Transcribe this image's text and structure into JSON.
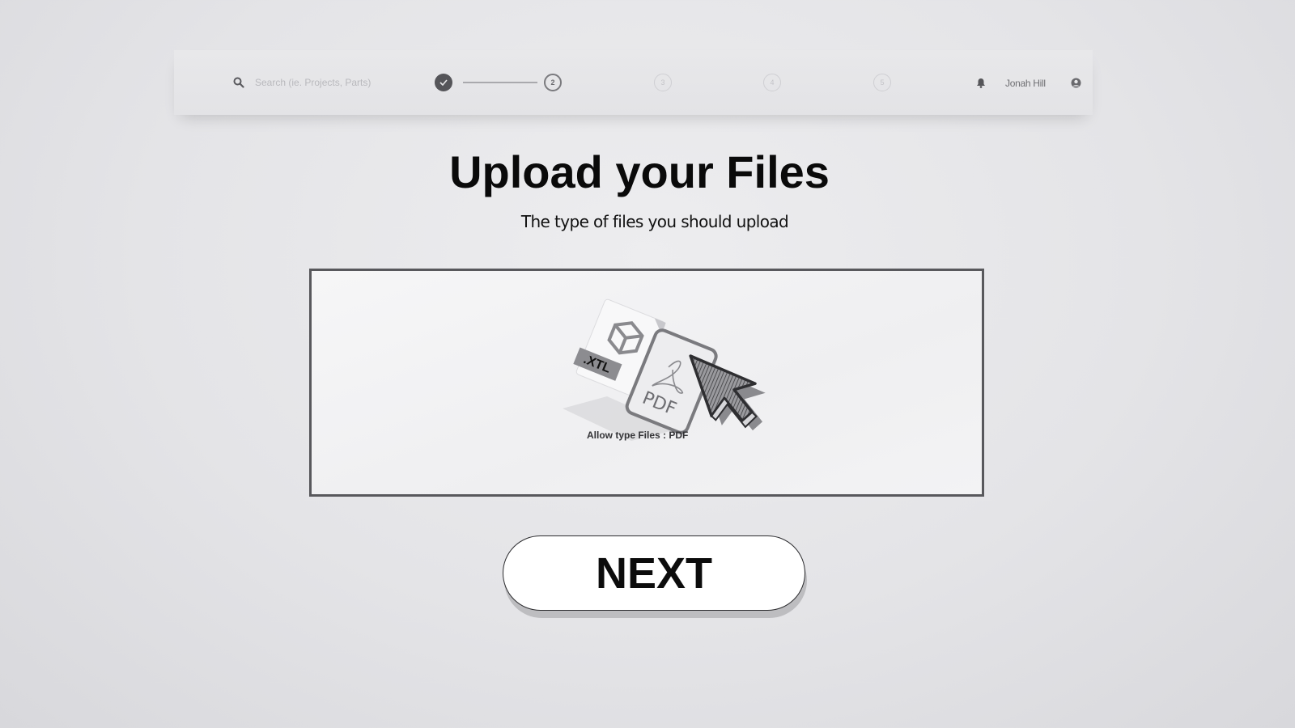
{
  "header": {
    "search": {
      "placeholder": "Search (ie. Projects, Parts)",
      "value": ""
    },
    "steps": [
      {
        "label": "",
        "state": "completed",
        "icon": "check-icon"
      },
      {
        "label": "2",
        "state": "current"
      },
      {
        "label": "3",
        "state": "upcoming"
      },
      {
        "label": "4",
        "state": "upcoming"
      },
      {
        "label": "5",
        "state": "upcoming"
      }
    ],
    "notification_icon": "bell-icon",
    "user": {
      "name": "Jonah Hill",
      "avatar_icon": "user-circle-icon"
    }
  },
  "main": {
    "title": "Upload your Files",
    "subtitle": "The type of files you should upload",
    "dropzone": {
      "file_tags": [
        ".XTL",
        "PDF"
      ],
      "allowed_types_label": "Allow type Files : PDF",
      "icons": [
        "cube-icon",
        "pdf-icon",
        "cursor-icon"
      ]
    },
    "next_button": {
      "label": "NEXT"
    }
  },
  "colors": {
    "background": "#e4e4e7",
    "step_done": "#555559",
    "dropzone_border": "#58585c",
    "text_primary": "#0a0a0a"
  }
}
